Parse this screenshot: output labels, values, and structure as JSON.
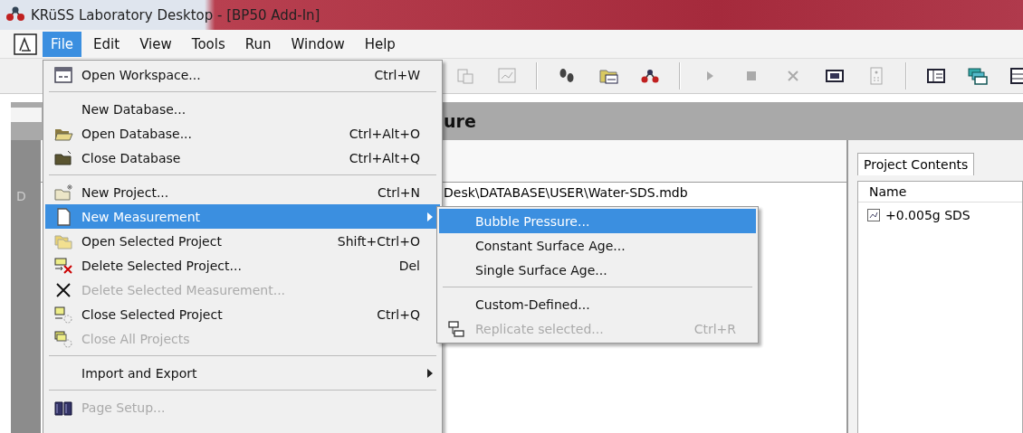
{
  "window": {
    "title": "KRüSS Laboratory Desktop - [BP50 Add-In]"
  },
  "menubar": [
    {
      "label": "File",
      "selected": true
    },
    {
      "label": "Edit",
      "selected": false
    },
    {
      "label": "View",
      "selected": false
    },
    {
      "label": "Tools",
      "selected": false
    },
    {
      "label": "Run",
      "selected": false
    },
    {
      "label": "Window",
      "selected": false
    },
    {
      "label": "Help",
      "selected": false
    }
  ],
  "header": {
    "title": "ure"
  },
  "sidebar": {
    "label": "D"
  },
  "database_path": "Desk\\DATABASE\\USER\\Water-SDS.mdb",
  "project_panel": {
    "tab": "Project Contents",
    "column": "Name",
    "rows": [
      "+0.005g SDS"
    ]
  },
  "file_menu": {
    "items": [
      {
        "kind": "item",
        "label": "Open Workspace...",
        "shortcut": "Ctrl+W",
        "selected": false,
        "disabled": false
      },
      {
        "kind": "separator"
      },
      {
        "kind": "item",
        "label": "New Database...",
        "selected": false,
        "disabled": false
      },
      {
        "kind": "item",
        "label": "Open Database...",
        "shortcut": "Ctrl+Alt+O",
        "selected": false,
        "disabled": false
      },
      {
        "kind": "item",
        "label": "Close Database",
        "shortcut": "Ctrl+Alt+Q",
        "selected": false,
        "disabled": false
      },
      {
        "kind": "separator"
      },
      {
        "kind": "item",
        "label": "New Project...",
        "shortcut": "Ctrl+N",
        "selected": false,
        "disabled": false
      },
      {
        "kind": "submenu",
        "label": "New Measurement",
        "selected": true,
        "disabled": false
      },
      {
        "kind": "item",
        "label": "Open Selected Project",
        "shortcut": "Shift+Ctrl+O",
        "selected": false,
        "disabled": false
      },
      {
        "kind": "item",
        "label": "Delete Selected Project...",
        "shortcut": "Del",
        "selected": false,
        "disabled": false
      },
      {
        "kind": "item",
        "label": "Delete Selected Measurement...",
        "selected": false,
        "disabled": true
      },
      {
        "kind": "item",
        "label": "Close Selected Project",
        "shortcut": "Ctrl+Q",
        "selected": false,
        "disabled": false
      },
      {
        "kind": "item",
        "label": "Close All Projects",
        "selected": false,
        "disabled": true
      },
      {
        "kind": "separator"
      },
      {
        "kind": "submenu",
        "label": "Import and Export",
        "selected": false,
        "disabled": false
      },
      {
        "kind": "separator"
      },
      {
        "kind": "item",
        "label": "Page Setup...",
        "selected": false,
        "disabled": true
      }
    ]
  },
  "submenu": {
    "items": [
      {
        "kind": "item",
        "label": "Bubble Pressure...",
        "selected": true,
        "disabled": false
      },
      {
        "kind": "item",
        "label": "Constant Surface Age...",
        "selected": false,
        "disabled": false
      },
      {
        "kind": "item",
        "label": "Single Surface Age...",
        "selected": false,
        "disabled": false
      },
      {
        "kind": "separator"
      },
      {
        "kind": "item",
        "label": "Custom-Defined...",
        "selected": false,
        "disabled": false
      },
      {
        "kind": "item",
        "label": "Replicate selected...",
        "shortcut": "Ctrl+R",
        "selected": false,
        "disabled": true
      }
    ]
  }
}
